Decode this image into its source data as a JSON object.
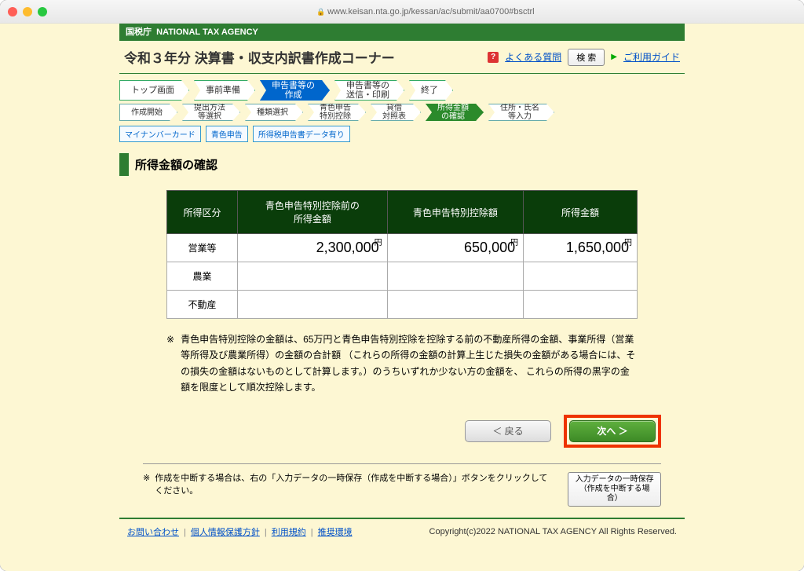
{
  "url": "www.keisan.nta.go.jp/kessan/ac/submit/aa0700#bsctrl",
  "agency": {
    "jp": "国税庁",
    "en": "NATIONAL TAX AGENCY"
  },
  "page_title": "令和３年分 決算書・収支内訳書作成コーナー",
  "header_links": {
    "faq": "よくある質問",
    "search_btn": "検 索",
    "guide": "ご利用ガイド"
  },
  "steps_main": [
    "トップ画面",
    "事前準備",
    "申告書等の\n作成",
    "申告書等の\n送信・印刷",
    "終了"
  ],
  "steps_main_active_index": 2,
  "steps_sub": [
    "作成開始",
    "提出方法\n等選択",
    "種類選択",
    "青色申告\n特別控除",
    "貸借\n対照表",
    "所得金額\nの確認",
    "住所・氏名\n等入力"
  ],
  "steps_sub_active_index": 5,
  "tags": [
    "マイナンバーカード",
    "青色申告",
    "所得税申告書データ有り"
  ],
  "section_title": "所得金額の確認",
  "table": {
    "headers": [
      "所得区分",
      "青色申告特別控除前の\n所得金額",
      "青色申告特別控除額",
      "所得金額"
    ],
    "yen_label": "円",
    "rows": [
      {
        "label": "営業等",
        "before": "2,300,000",
        "deduction": "650,000",
        "income": "1,650,000"
      },
      {
        "label": "農業",
        "before": "",
        "deduction": "",
        "income": ""
      },
      {
        "label": "不動産",
        "before": "",
        "deduction": "",
        "income": ""
      }
    ]
  },
  "note": "青色申告特別控除の金額は、65万円と青色申告特別控除を控除する前の不動産所得の金額、事業所得（営業等所得及び農業所得）の金額の合計額 （これらの所得の金額の計算上生じた損失の金額がある場合には、その損失の金額はないものとして計算します。）のうちいずれか少ない方の金額を、 これらの所得の黒字の金額を限度として順次控除します。",
  "asterisk": "※",
  "buttons": {
    "back": "＜ 戻る",
    "next": "次へ ＞"
  },
  "interrupt": {
    "text": "作成を中断する場合は、右の「入力データの一時保存（作成を中断する場合）」ボタンをクリックしてください。",
    "btn_l1": "入力データの一時保存",
    "btn_l2": "（作成を中断する場合）"
  },
  "footer": {
    "links": [
      "お問い合わせ",
      "個人情報保護方針",
      "利用規約",
      "推奨環境"
    ],
    "copyright": "Copyright(c)2022 NATIONAL TAX AGENCY All Rights Reserved."
  }
}
